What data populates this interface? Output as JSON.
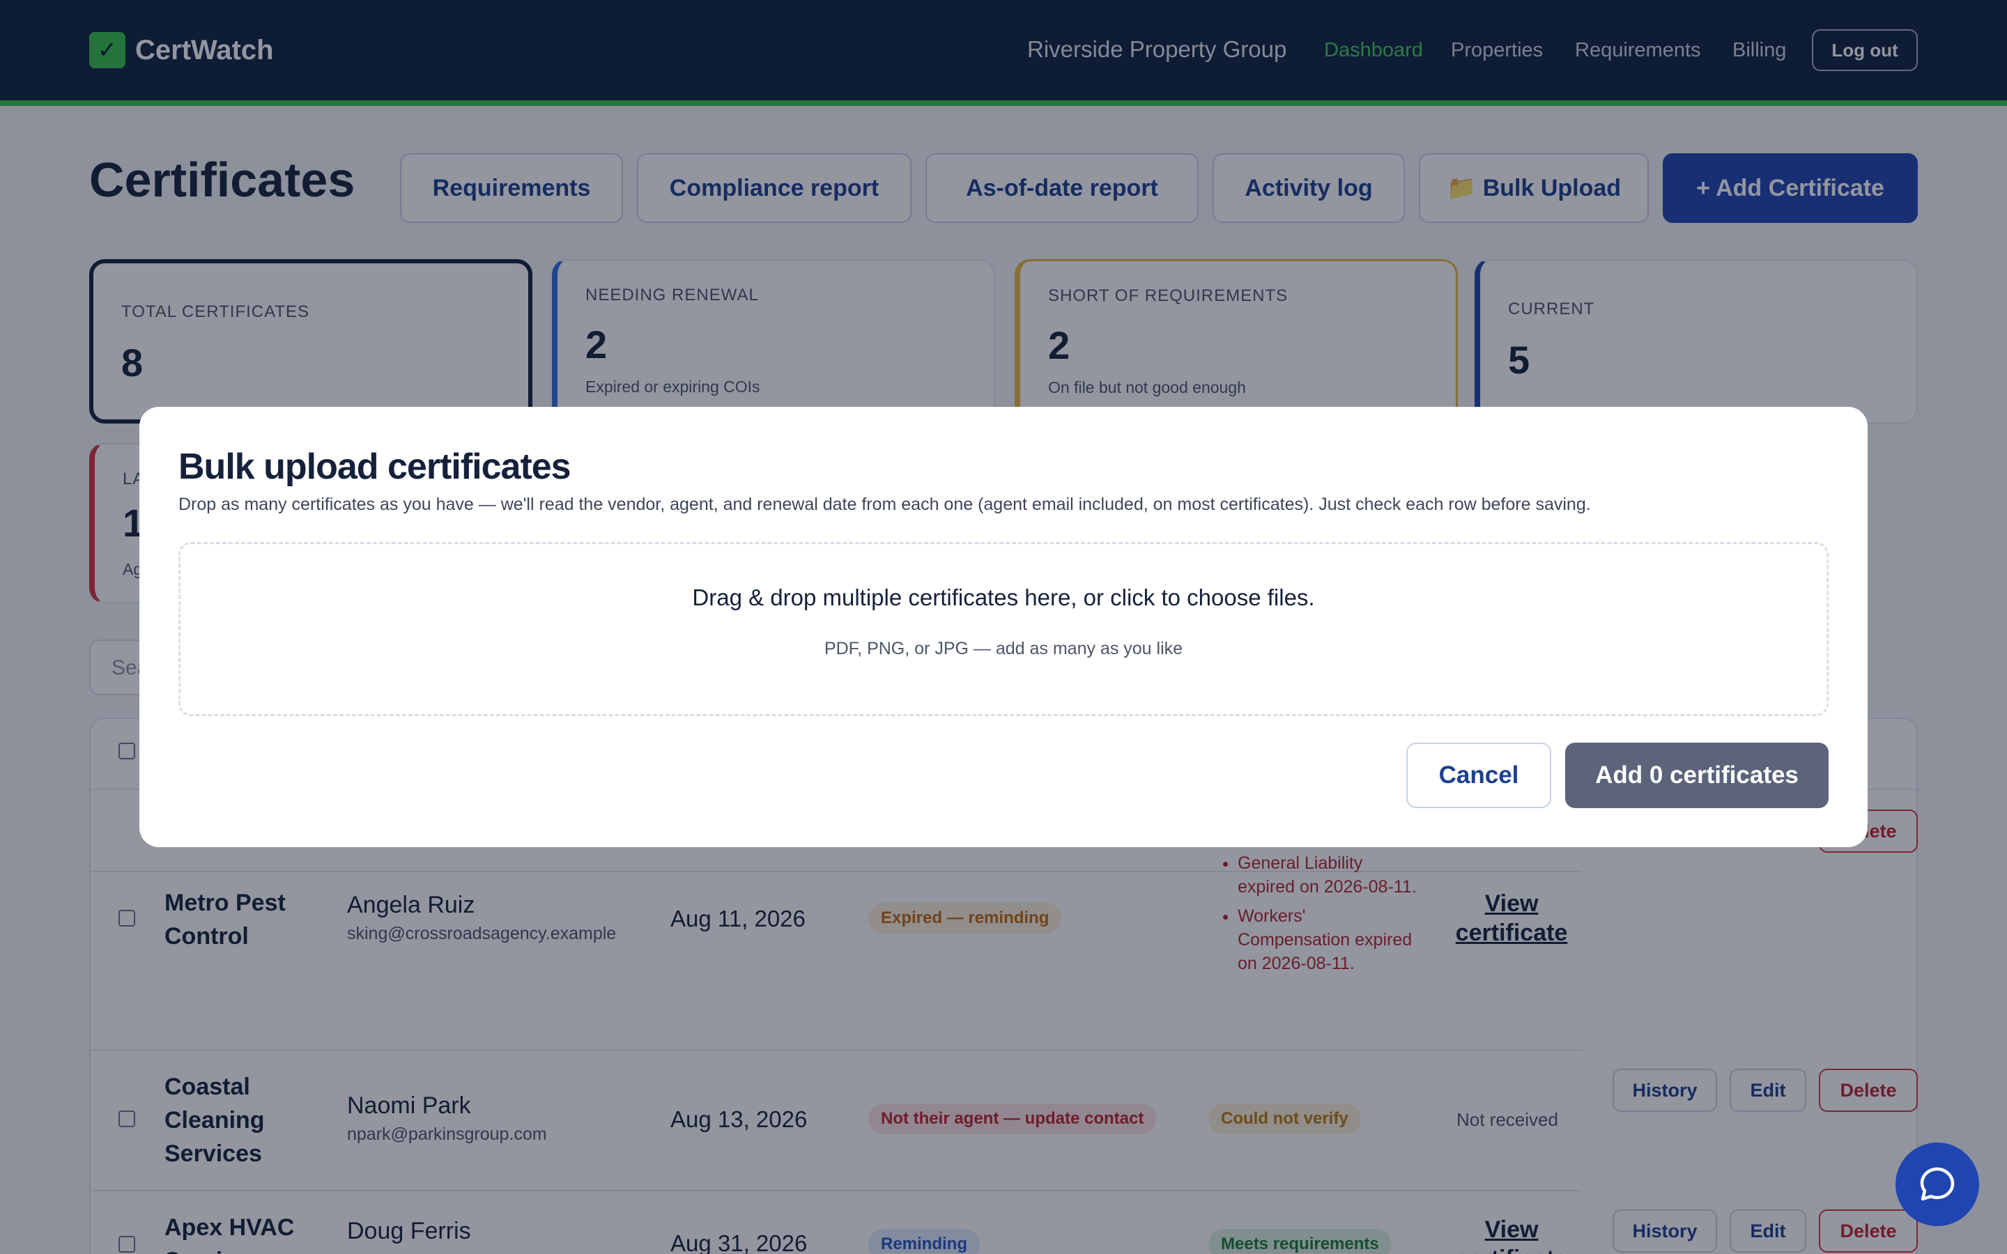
{
  "app": {
    "name": "CertWatch",
    "logo_glyph": "✓",
    "org": "Riverside Property Group",
    "nav": [
      "Dashboard",
      "Properties",
      "Requirements",
      "Billing"
    ],
    "active_nav": "Dashboard",
    "logout": "Log out",
    "accent": "#35c24a",
    "navy": "#10213f"
  },
  "page": {
    "title": "Certificates",
    "actions": [
      "Requirements",
      "Compliance report",
      "As-of-date report",
      "Activity log",
      "📁 Bulk Upload",
      "+ Add Certificate"
    ]
  },
  "stats": [
    {
      "label": "TOTAL CERTIFICATES",
      "value": "8",
      "sub": ""
    },
    {
      "label": "NEEDING RENEWAL",
      "value": "2",
      "sub": "Expired or expiring COIs"
    },
    {
      "label": "SHORT OF REQUIREMENTS",
      "value": "2",
      "sub": "On file but not good enough"
    },
    {
      "label": "CURRENT",
      "value": "5",
      "sub": ""
    }
  ],
  "stats_row2": {
    "label": "LA",
    "value": "1",
    "sub": "Ag"
  },
  "search": {
    "placeholder": "Sea"
  },
  "table": {
    "rows": [
      {
        "vendor": "Metro Pest Control",
        "agent": "Angela Ruiz",
        "email": "sking@crossroadsagency.example",
        "date": "Aug 11, 2026",
        "status": "Expired — reminding",
        "issues": [
          "General Liability expired on 2026-08-11.",
          "Workers' Compensation expired on 2026-08-11."
        ],
        "certificate": "View certificate"
      },
      {
        "vendor": "Coastal Cleaning Services",
        "agent": "Naomi Park",
        "email": "npark@parkinsgroup.com",
        "date": "Aug 13, 2026",
        "status": "Not their agent — update contact",
        "requirements": "Could not verify",
        "certificate": "Not received"
      },
      {
        "vendor": "Apex HVAC Services",
        "agent": "Doug Ferris",
        "email": "",
        "date": "Aug 31, 2026",
        "status": "Reminding",
        "requirements": "Meets requirements",
        "certificate": "View certificate"
      }
    ],
    "row_actions": [
      "History",
      "Edit",
      "Delete"
    ]
  },
  "modal": {
    "title": "Bulk upload certificates",
    "description": "Drop as many certificates as you have — we'll read the vendor, agent, and renewal date from each one (agent email included, on most certificates). Just check each row before saving.",
    "dropzone_main": "Drag & drop multiple certificates here, or click to choose files.",
    "dropzone_sub": "PDF, PNG, or JPG — add as many as you like",
    "cancel": "Cancel",
    "submit": "Add 0 certificates"
  },
  "icons": {
    "chat": "chat-bubble-icon"
  }
}
